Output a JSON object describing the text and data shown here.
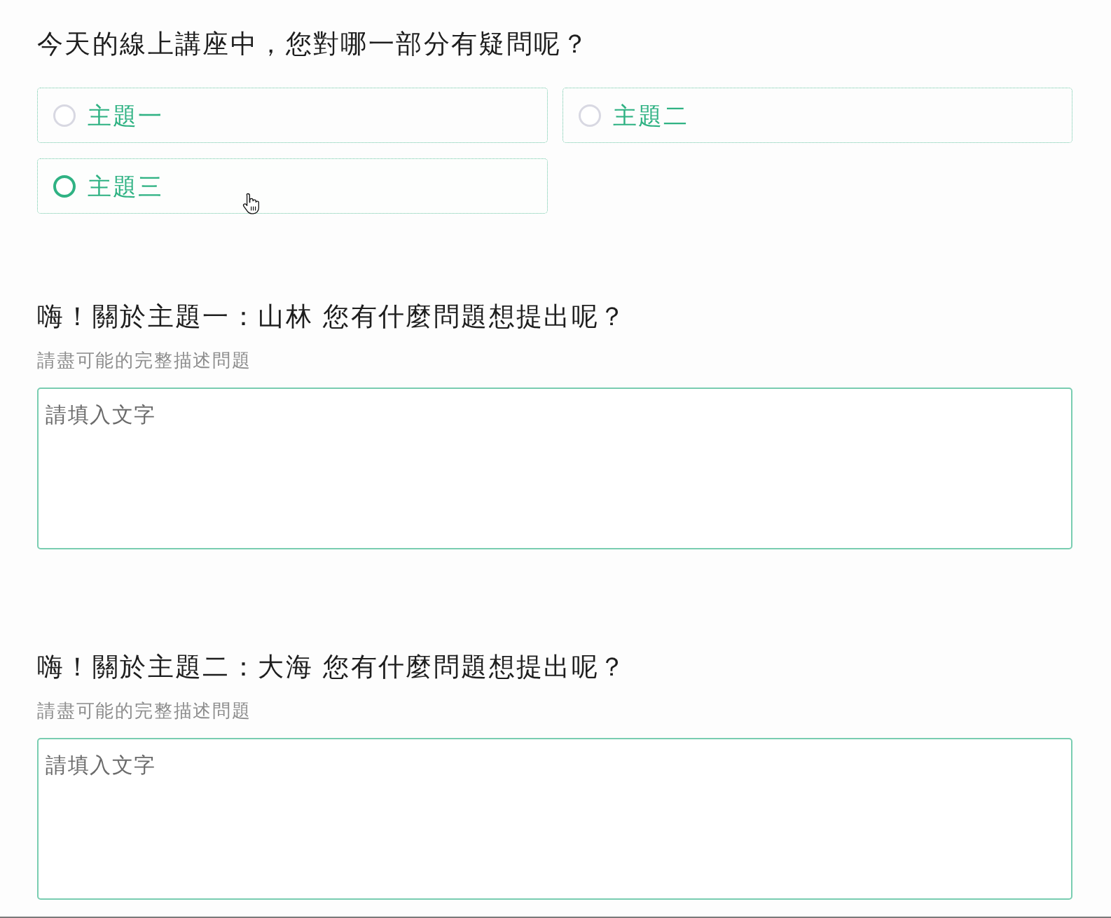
{
  "questions": [
    {
      "kind": "choice",
      "title": "今天的線上講座中，您對哪一部分有疑問呢？",
      "options": [
        {
          "label": "主題一",
          "selected": false,
          "hovered": false
        },
        {
          "label": "主題二",
          "selected": false,
          "hovered": false
        },
        {
          "label": "主題三",
          "selected": false,
          "hovered": true
        }
      ]
    },
    {
      "kind": "text",
      "title": "嗨！關於主題一：山林 您有什麼問題想提出呢？",
      "hint": "請盡可能的完整描述問題",
      "placeholder": "請填入文字"
    },
    {
      "kind": "text",
      "title": "嗨！關於主題二：大海 您有什麼問題想提出呢？",
      "hint": "請盡可能的完整描述問題",
      "placeholder": "請填入文字"
    }
  ]
}
